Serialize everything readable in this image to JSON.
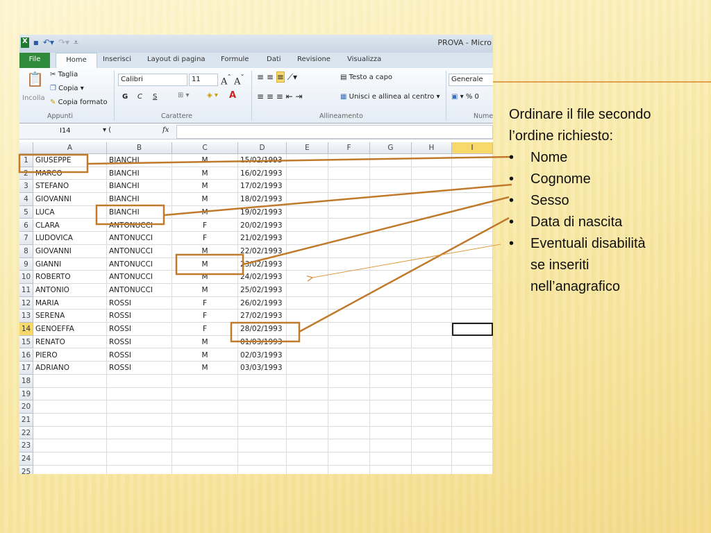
{
  "window": {
    "title": "PROVA - Micro"
  },
  "tabs": [
    "File",
    "Home",
    "Inserisci",
    "Layout di pagina",
    "Formule",
    "Dati",
    "Revisione",
    "Visualizza"
  ],
  "ribbon": {
    "clipboard": {
      "paste": "Incolla",
      "cut": "Taglia",
      "copy": "Copia",
      "format_painter": "Copia formato",
      "group": "Appunti"
    },
    "font": {
      "name": "Calibri",
      "size": "11",
      "bold": "G",
      "italic": "C",
      "underline": "S",
      "group": "Carattere"
    },
    "alignment": {
      "wrap": "Testo a capo",
      "merge": "Unisci e allinea al centro",
      "group": "Allineamento"
    },
    "number": {
      "format": "Generale",
      "percent": "%",
      "group": "Nume"
    }
  },
  "formula_bar": {
    "name_box": "I14",
    "fx": "fx",
    "value": ""
  },
  "sheet": {
    "columns": [
      "A",
      "B",
      "C",
      "D",
      "E",
      "F",
      "G",
      "H",
      "I"
    ],
    "selected_column": "I",
    "selected_row": 14,
    "row_count": 25,
    "rows": [
      [
        "GIUSEPPE",
        "BIANCHI",
        "M",
        "15/02/1993"
      ],
      [
        "MARCO",
        "BIANCHI",
        "M",
        "16/02/1993"
      ],
      [
        "STEFANO",
        "BIANCHI",
        "M",
        "17/02/1993"
      ],
      [
        "GIOVANNI",
        "BIANCHI",
        "M",
        "18/02/1993"
      ],
      [
        "LUCA",
        "BIANCHI",
        "M",
        "19/02/1993"
      ],
      [
        "CLARA",
        "ANTONUCCI",
        "F",
        "20/02/1993"
      ],
      [
        "LUDOVICA",
        "ANTONUCCI",
        "F",
        "21/02/1993"
      ],
      [
        "GIOVANNI",
        "ANTONUCCI",
        "M",
        "22/02/1993"
      ],
      [
        "GIANNI",
        "ANTONUCCI",
        "M",
        "23/02/1993"
      ],
      [
        "ROBERTO",
        "ANTONUCCI",
        "M",
        "24/02/1993"
      ],
      [
        "ANTONIO",
        "ANTONUCCI",
        "M",
        "25/02/1993"
      ],
      [
        "MARIA",
        "ROSSI",
        "F",
        "26/02/1993"
      ],
      [
        "SERENA",
        "ROSSI",
        "F",
        "27/02/1993"
      ],
      [
        "GENOEFFA",
        "ROSSI",
        "F",
        "28/02/1993"
      ],
      [
        "RENATO",
        "ROSSI",
        "M",
        "01/03/1993"
      ],
      [
        "PIERO",
        "ROSSI",
        "M",
        "02/03/1993"
      ],
      [
        "ADRIANO",
        "ROSSI",
        "M",
        "03/03/1993"
      ]
    ]
  },
  "notes": {
    "intro": "Ordinare il file secondo l’ordine richiesto:",
    "items": [
      "Nome",
      "Cognome",
      "Sesso",
      "Data di nascita",
      "Eventuali disabilità"
    ],
    "continuation": [
      "se inseriti",
      "nell’anagrafico"
    ]
  },
  "colors": {
    "annotation": "#c07a2c",
    "selection": "#f7d86a",
    "slide_background": "#f7e9aa"
  }
}
